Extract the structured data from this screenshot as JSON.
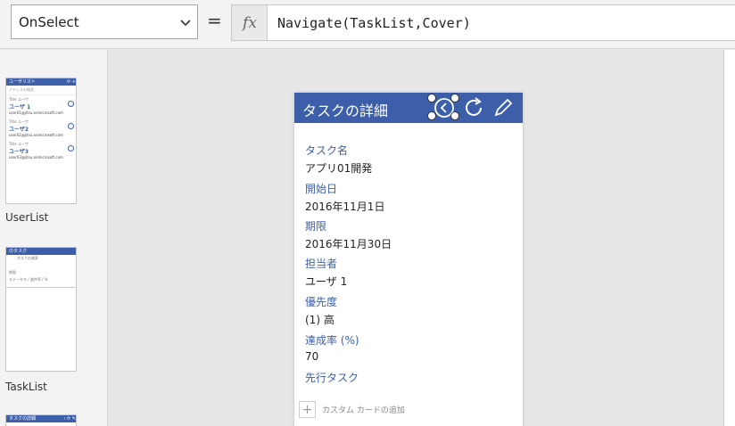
{
  "formula_bar": {
    "property": "OnSelect",
    "equals": "=",
    "fx": "fx",
    "formula": "Navigate(TaskList,Cover)"
  },
  "thumbnails": [
    {
      "label": "UserList",
      "header": "ユーザリスト",
      "search": "アドレスの検索",
      "items": [
        {
          "caption": "Title ユーザ",
          "name": "ユーザ 1",
          "mail": "user01@jitsu.onmicrosoft.com"
        },
        {
          "caption": "Title ユーザ",
          "name": "ユーザ2",
          "mail": "user02@jitsu.onmicrosoft.com"
        },
        {
          "caption": "Title ユーザ",
          "name": "ユーザ3",
          "mail": "user03@jitsu.onmicrosoft.com"
        }
      ]
    },
    {
      "label": "TaskList",
      "header": "のタスク",
      "line1": "タスクの検索",
      "line2": "期限",
      "line3": "ステータス / 進捗率 / %"
    },
    {
      "label": "",
      "header": "タスクの詳細"
    }
  ],
  "screen": {
    "title": "タスクの詳細",
    "fields": [
      {
        "label": "タスク名",
        "value": "アプリ01開発"
      },
      {
        "label": "開始日",
        "value": "2016年11月1日"
      },
      {
        "label": "期限",
        "value": "2016年11月30日"
      },
      {
        "label": "担当者",
        "value": "ユーザ 1"
      },
      {
        "label": "優先度",
        "value": "(1) 高"
      },
      {
        "label": "達成率 (%)",
        "value": "70"
      },
      {
        "label": "先行タスク",
        "value": ""
      }
    ],
    "add_card": "カスタム カードの追加",
    "icons": [
      "back-icon",
      "refresh-icon",
      "edit-icon"
    ]
  },
  "colors": {
    "accent": "#3d5ea8"
  }
}
